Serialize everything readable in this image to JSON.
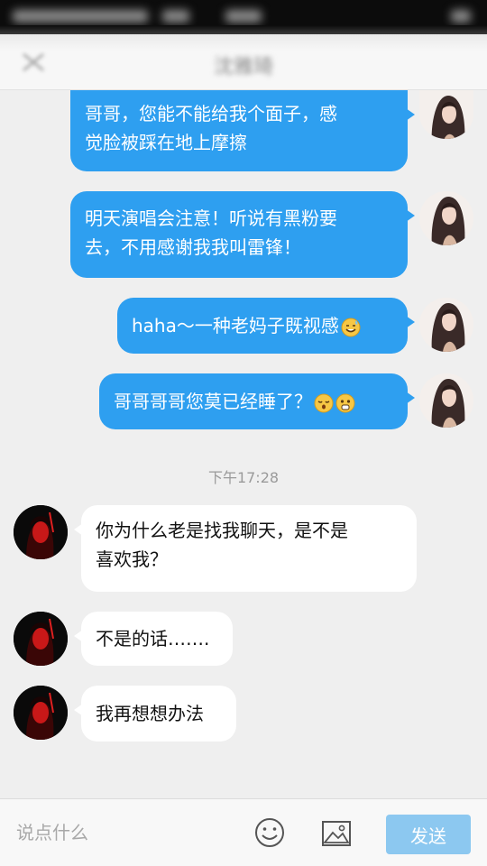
{
  "header": {
    "title": "沈雅琦"
  },
  "messages_outgoing": [
    {
      "line1": "哥哥，您能不能给我个面子，感",
      "line2": "觉脸被踩在地上摩擦"
    },
    {
      "line1": "明天演唱会注意！听说有黑粉要",
      "line2": "去，不用感谢我我叫雷锋！"
    },
    {
      "text": "haha～一种老妈子既视感"
    },
    {
      "text": "哥哥哥哥您莫已经睡了？"
    }
  ],
  "timestamp": "下午17:28",
  "messages_incoming": [
    {
      "line1": "你为什么老是找我聊天，是不是",
      "line2": "喜欢我？"
    },
    {
      "text": "不是的话……."
    },
    {
      "text": "我再想想办法"
    }
  ],
  "input_bar": {
    "placeholder": "说点什么",
    "send_label": "发送",
    "emoji_icon": "smiley-face-icon",
    "image_icon": "image-icon"
  },
  "colors": {
    "outgoing_bubble": "#2e9ff0",
    "incoming_bubble": "#ffffff",
    "background": "#efefef",
    "send_button": "#8cc8f0"
  }
}
